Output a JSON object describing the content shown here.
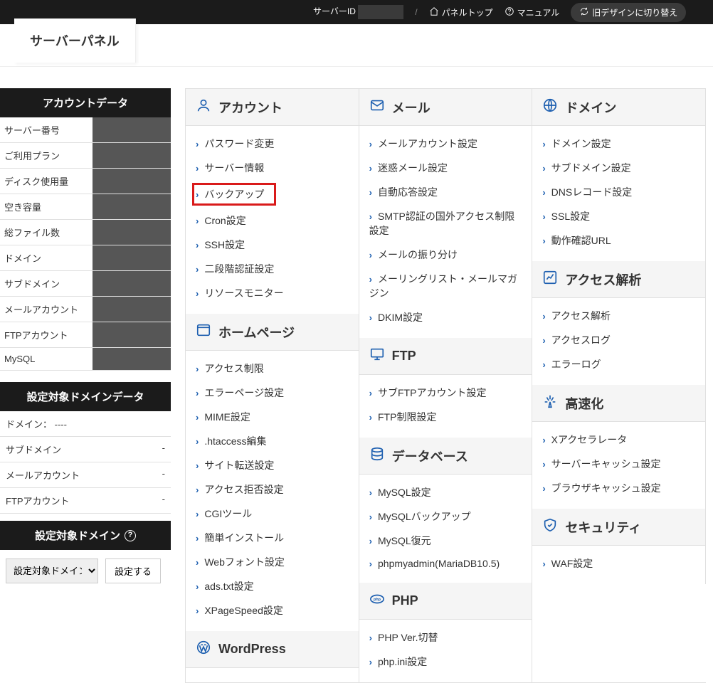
{
  "topbar": {
    "serverid_label": "サーバーID",
    "serverid_value": "",
    "panel_top": "パネルトップ",
    "manual": "マニュアル",
    "switch": "旧デザインに切り替え"
  },
  "title": "サーバーパネル",
  "sidebar": {
    "account_data_head": "アカウントデータ",
    "rows": [
      {
        "label": "サーバー番号",
        "value": ""
      },
      {
        "label": "ご利用プラン",
        "value": ""
      },
      {
        "label": "ディスク使用量",
        "value": ""
      },
      {
        "label": "空き容量",
        "value": ""
      },
      {
        "label": "総ファイル数",
        "value": ""
      },
      {
        "label": "ドメイン",
        "value": ""
      },
      {
        "label": "サブドメイン",
        "value": ""
      },
      {
        "label": "メールアカウント",
        "value": ""
      },
      {
        "label": "FTPアカウント",
        "value": ""
      },
      {
        "label": "MySQL",
        "value": ""
      }
    ],
    "domain_data_head": "設定対象ドメインデータ",
    "domain_label": "ドメイン：",
    "domain_value": "----",
    "drows": [
      {
        "label": "サブドメイン",
        "value": "-"
      },
      {
        "label": "メールアカウント",
        "value": "-"
      },
      {
        "label": "FTPアカウント",
        "value": "-"
      }
    ],
    "select_domain_head": "設定対象ドメイン",
    "select_placeholder": "設定対象ドメイン:",
    "select_button": "設定する"
  },
  "categories": [
    {
      "icon": "user",
      "title": "アカウント",
      "items": [
        "パスワード変更",
        "サーバー情報",
        "バックアップ",
        "Cron設定",
        "SSH設定",
        "二段階認証設定",
        "リソースモニター"
      ],
      "highlight_index": 2
    },
    {
      "icon": "mail",
      "title": "メール",
      "items": [
        "メールアカウント設定",
        "迷惑メール設定",
        "自動応答設定",
        "SMTP認証の国外アクセス制限設定",
        "メールの振り分け",
        "メーリングリスト・メールマガジン",
        "DKIM設定"
      ]
    },
    {
      "icon": "globe",
      "title": "ドメイン",
      "items": [
        "ドメイン設定",
        "サブドメイン設定",
        "DNSレコード設定",
        "SSL設定",
        "動作確認URL"
      ]
    },
    {
      "icon": "window",
      "title": "ホームページ",
      "items": [
        "アクセス制限",
        "エラーページ設定",
        "MIME設定",
        ".htaccess編集",
        "サイト転送設定",
        "アクセス拒否設定",
        "CGIツール",
        "簡単インストール",
        "Webフォント設定",
        "ads.txt設定",
        "XPageSpeed設定"
      ]
    },
    {
      "icon": "monitor",
      "title": "FTP",
      "items": [
        "サブFTPアカウント設定",
        "FTP制限設定"
      ]
    },
    {
      "icon": "chart",
      "title": "アクセス解析",
      "items": [
        "アクセス解析",
        "アクセスログ",
        "エラーログ"
      ]
    },
    {
      "icon": "database",
      "title": "データベース",
      "items": [
        "MySQL設定",
        "MySQLバックアップ",
        "MySQL復元",
        "phpmyadmin(MariaDB10.5)"
      ]
    },
    {
      "icon": "speed",
      "title": "高速化",
      "items": [
        "Xアクセラレータ",
        "サーバーキャッシュ設定",
        "ブラウザキャッシュ設定"
      ]
    },
    {
      "icon": "php",
      "title": "PHP",
      "items": [
        "PHP Ver.切替",
        "php.ini設定"
      ]
    },
    {
      "icon": "shield",
      "title": "セキュリティ",
      "items": [
        "WAF設定"
      ]
    },
    {
      "icon": "wordpress",
      "title": "WordPress",
      "items": []
    }
  ]
}
